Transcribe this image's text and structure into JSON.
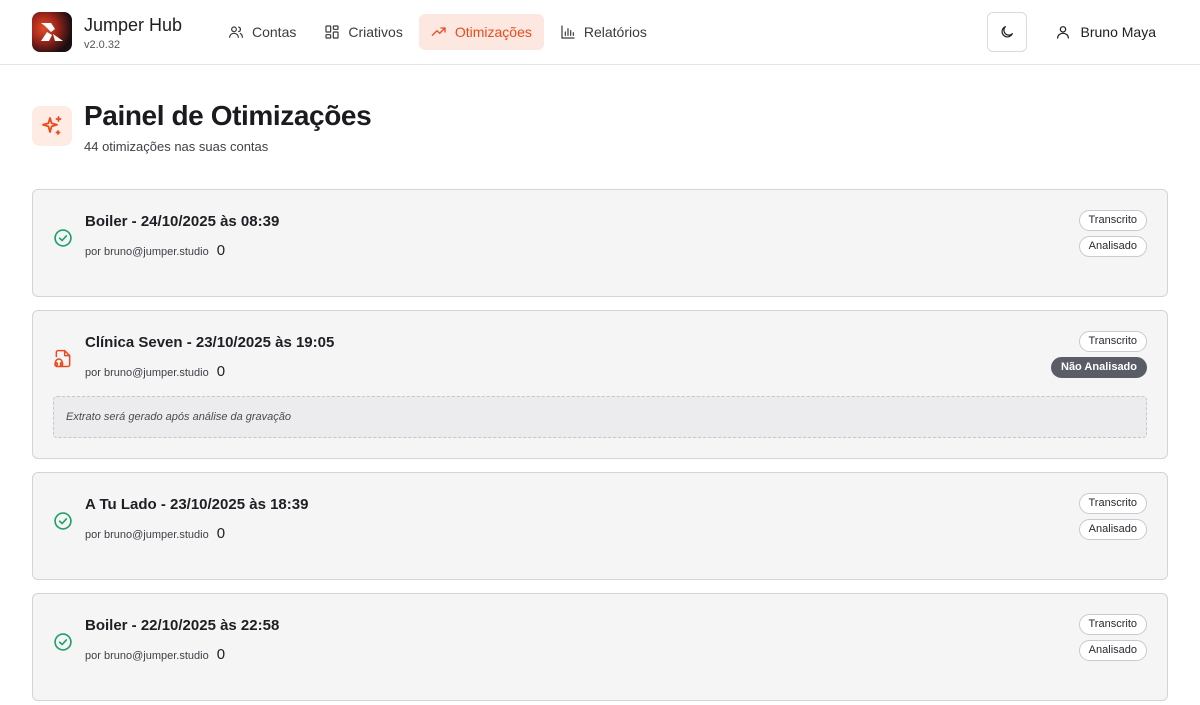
{
  "app": {
    "title": "Jumper Hub",
    "version": "v2.0.32"
  },
  "nav": [
    {
      "label": "Contas",
      "icon": "users-icon",
      "active": false
    },
    {
      "label": "Criativos",
      "icon": "grid-icon",
      "active": false
    },
    {
      "label": "Otimizações",
      "icon": "trending-up-icon",
      "active": true
    },
    {
      "label": "Relatórios",
      "icon": "bar-chart-icon",
      "active": false
    }
  ],
  "user": {
    "name": "Bruno Maya"
  },
  "page": {
    "title": "Painel de Otimizações",
    "subtitle": "44 otimizações nas suas contas"
  },
  "colors": {
    "accent": "#ea4a1c",
    "success": "#22a06b"
  },
  "items": [
    {
      "title": "Boiler - 24/10/2025 às 08:39",
      "author": "por bruno@jumper.studio",
      "count": "0",
      "status": "check-circle-icon",
      "badges": [
        "Transcrito",
        "Analisado"
      ]
    },
    {
      "title": "Clínica Seven - 23/10/2025 às 19:05",
      "author": "por bruno@jumper.studio",
      "count": "0",
      "status": "audio-file-icon",
      "badges": [
        "Transcrito",
        "Não Analisado"
      ],
      "extract": "Extrato será gerado após análise da gravação"
    },
    {
      "title": "A Tu Lado - 23/10/2025 às 18:39",
      "author": "por bruno@jumper.studio",
      "count": "0",
      "status": "check-circle-icon",
      "badges": [
        "Transcrito",
        "Analisado"
      ]
    },
    {
      "title": "Boiler - 22/10/2025 às 22:58",
      "author": "por bruno@jumper.studio",
      "count": "0",
      "status": "check-circle-icon",
      "badges": [
        "Transcrito",
        "Analisado"
      ]
    }
  ]
}
